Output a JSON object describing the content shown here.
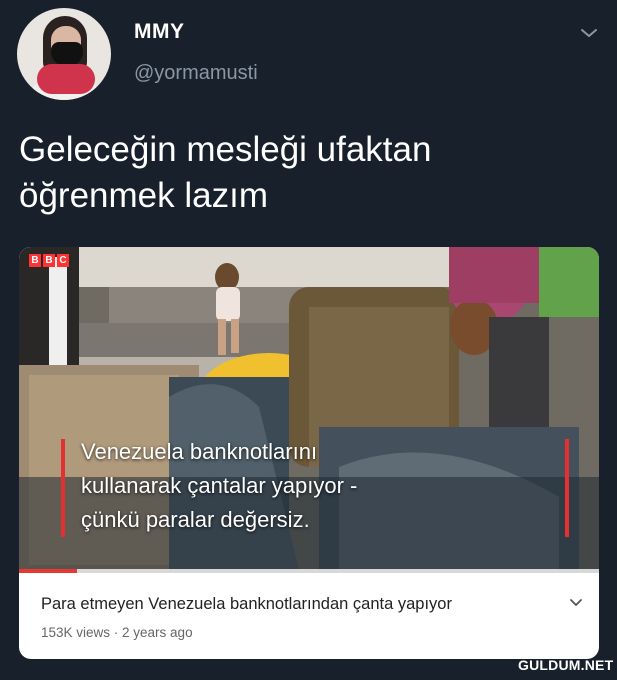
{
  "user": {
    "display_name": "MMY",
    "handle": "@yormamusti"
  },
  "tweet": {
    "text_line1": "Geleceğin mesleği ufaktan",
    "text_line2": "öğrenmek lazım"
  },
  "video": {
    "logo": "BBC",
    "caption_line1": "Venezuela banknotlarını",
    "caption_line2": "kullanarak çantalar yapıyor -",
    "caption_line3": "çünkü paralar değersiz.",
    "title": "Para etmeyen Venezuela banknotlarından çanta yapıyor",
    "views": "153K views",
    "age": "2 years ago",
    "meta": "153K views · 2 years ago",
    "progress_fraction": 0.1
  },
  "watermark": "GULDUM.NET",
  "icons": {
    "header_menu": "chevron-down-icon",
    "card_expand": "chevron-down-icon"
  },
  "colors": {
    "background": "#18202b",
    "handle": "#8a97a4",
    "progress": "#e53935"
  }
}
